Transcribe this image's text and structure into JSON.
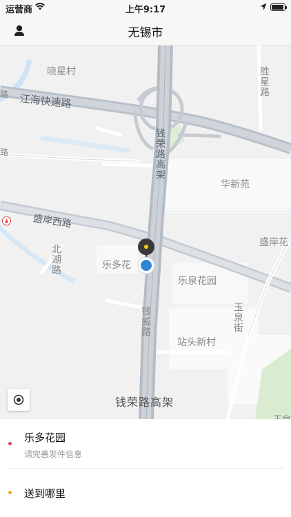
{
  "status_bar": {
    "carrier": "运营商",
    "time": "上午9:17"
  },
  "nav": {
    "title": "无锡市",
    "profile_icon": "person-icon"
  },
  "map": {
    "labels": {
      "xiaoxingcun": "晓星村",
      "jianghai_road": "江海快速路",
      "shengxing_road": "胜星路",
      "qianrong_elevated_vertical": "钱荣路高架",
      "huaxinyuan": "华新苑",
      "shengan_west_road": "盛岸西路",
      "shengan_east": "盛岸花",
      "beihu_road": "北湖路",
      "leduo_map": "乐多花",
      "lequan_garden": "乐泉花园",
      "qianwei_road": "钱威路",
      "yuquan_street": "玉泉街",
      "zhantou_village": "站头新村",
      "qianrong_elevated_bottom": "钱荣路高架",
      "left_edge_lu": "路",
      "left_edge_lu2": "路",
      "corner_label": "王泉"
    },
    "locate_icon": "locate-icon",
    "pin_icon": "map-pin-icon"
  },
  "panel": {
    "pickup": {
      "title": "乐多花园",
      "subtitle": "请完善发件信息",
      "dot_color": "#e8424f"
    },
    "dropoff": {
      "title": "送到哪里",
      "dot_color": "#f5a623"
    }
  }
}
